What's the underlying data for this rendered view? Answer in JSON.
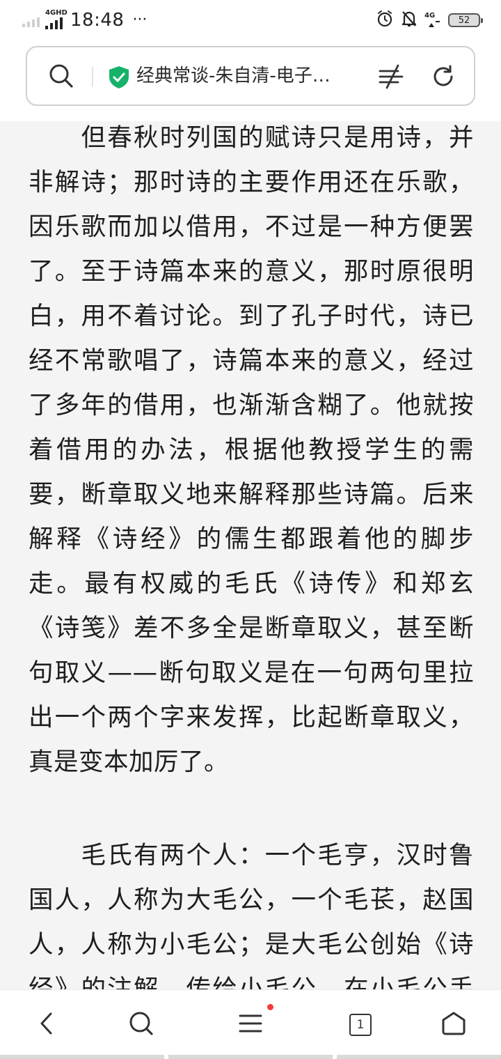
{
  "status_bar": {
    "network_type": "4GHD",
    "time": "18:48",
    "more": "···",
    "lte_label": "4G",
    "battery": "52"
  },
  "address_bar": {
    "title": "经典常谈-朱自清-电子…",
    "secure": true
  },
  "article": {
    "paragraphs": [
      {
        "lines": [
          "　　但春秋时列国的赋诗只是用诗，并",
          "非解诗；那时诗的主要作用还在乐歌，",
          "因乐歌而加以借用，不过是一种方便罢",
          "了。至于诗篇本来的意义，那时原很明",
          "白，用不着讨论。到了孔子时代，诗已",
          "经不常歌唱了，诗篇本来的意义，经过",
          "了多年的借用，也渐渐含糊了。他就按",
          "着借用的办法，根据他教授学生的需",
          "要，断章取义地来解释那些诗篇。后来",
          "解释《诗经》的儒生都跟着他的脚步",
          "走。最有权威的毛氏《诗传》和郑玄",
          "《诗笺》差不多全是断章取义，甚至断",
          "句取义——断句取义是在一句两句里拉",
          "出一个两个字来发挥，比起断章取义，",
          "真是变本加厉了。"
        ]
      },
      {
        "lines": [
          "　　毛氏有两个人：一个毛亨，汉时鲁",
          "国人，人称为大毛公，一个毛苌，赵国",
          "人，人称为小毛公；是大毛公创始《诗",
          "经》的注解，传给小毛公，在小毛公手"
        ]
      }
    ]
  },
  "bottom_nav": {
    "tab_count": "1",
    "menu_has_notification": true,
    "icons": [
      "back-icon",
      "search-icon",
      "menu-icon",
      "tabs-icon",
      "home-icon"
    ]
  },
  "colors": {
    "accent_green": "#17b26a",
    "notification_red": "#ef3b3b",
    "page_bg": "#f4f4f4"
  }
}
